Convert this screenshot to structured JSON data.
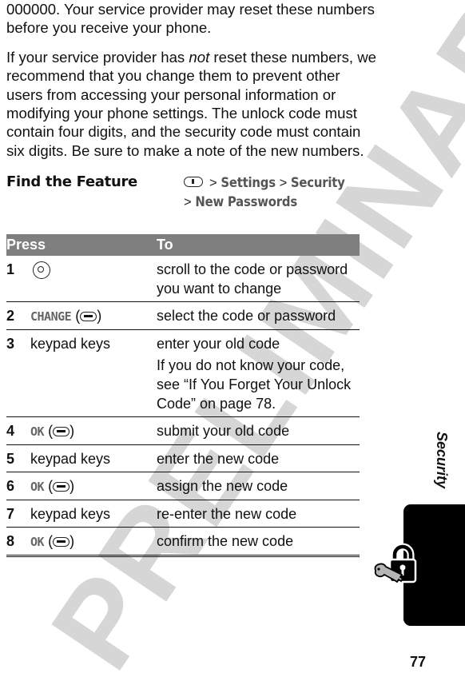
{
  "intro": {
    "paragraph1": "000000. Your service provider may reset these numbers before you receive your phone.",
    "paragraph2_before": "If your service provider has ",
    "paragraph2_emphasis": "not",
    "paragraph2_after": " reset these numbers, we recommend that you change them to prevent other users from accessing your personal information or modifying your phone settings. The unlock code must contain four digits, and the security code must contain six digits. Be sure to make a note of the new numbers."
  },
  "find_feature": {
    "label": "Find the Feature",
    "separator": ">",
    "path": [
      "Settings",
      "Security",
      "New Passwords"
    ],
    "menu_key_icon": "menu-key-icon"
  },
  "table": {
    "headers": {
      "press": "Press",
      "to": "To"
    },
    "rows": [
      {
        "num": "1",
        "press": "",
        "press_icon": "navigation-key-icon",
        "to": "scroll to the code or password you want to change"
      },
      {
        "num": "2",
        "press_soft": "CHANGE",
        "press_icon": "softkey-icon",
        "to": "select the code or password"
      },
      {
        "num": "3",
        "press": "keypad keys",
        "to": "enter your old code",
        "to_extra": "If you do not know your code, see “If You Forget Your Unlock Code” on page 78."
      },
      {
        "num": "4",
        "press_soft": "OK",
        "press_icon": "softkey-icon",
        "to": "submit your old code"
      },
      {
        "num": "5",
        "press": "keypad keys",
        "to": "enter the new code"
      },
      {
        "num": "6",
        "press_soft": "OK",
        "press_icon": "softkey-icon",
        "to": "assign the new code"
      },
      {
        "num": "7",
        "press": "keypad keys",
        "to": "re-enter the new code"
      },
      {
        "num": "8",
        "press_soft": "OK",
        "press_icon": "softkey-icon",
        "to": "confirm the new code"
      }
    ]
  },
  "side_tab": {
    "label": "Security",
    "icon": "lock-and-key-icon"
  },
  "watermark": "PRELIMINARY",
  "page_number": "77",
  "colors": {
    "header_bg": "#7f7f7f",
    "watermark": "#d6d6d6",
    "tab": "#000000"
  }
}
